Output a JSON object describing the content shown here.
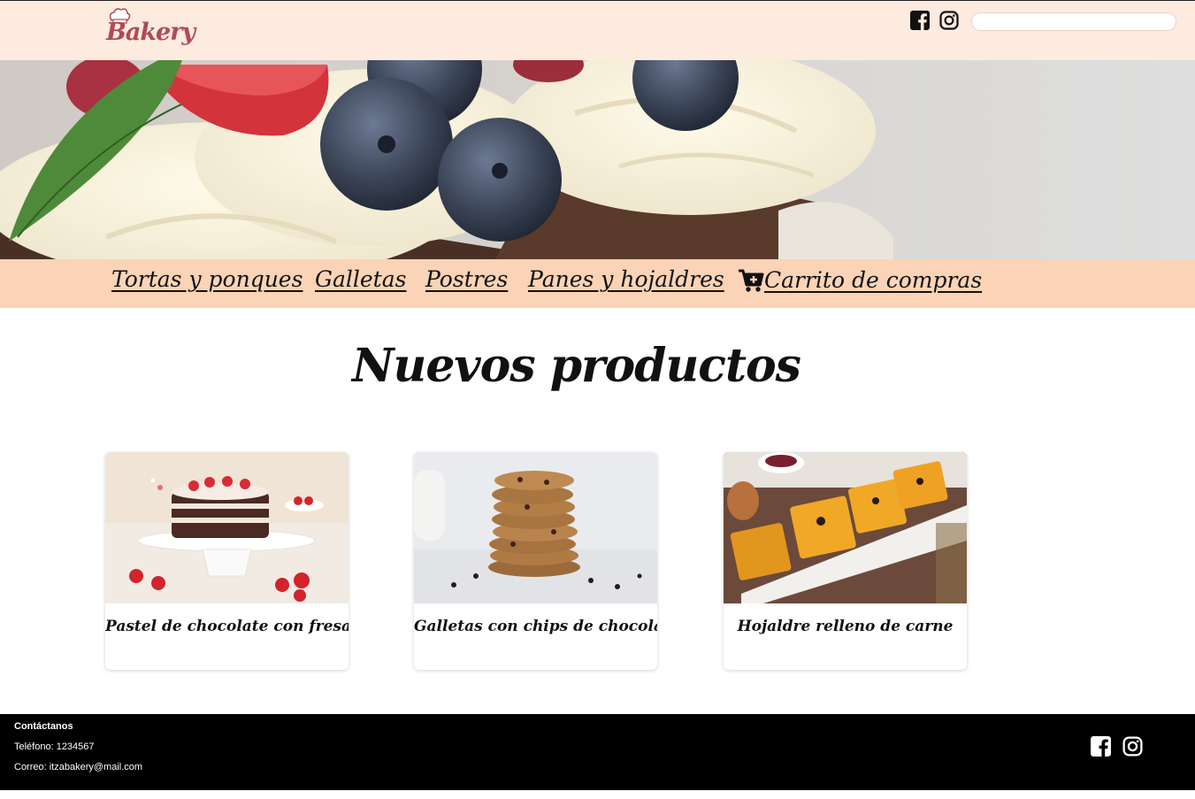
{
  "header": {
    "logo_text": "Bakery",
    "search": {
      "value": "",
      "placeholder": ""
    }
  },
  "nav": {
    "items": [
      {
        "label": "Tortas y ponques"
      },
      {
        "label": "Galletas"
      },
      {
        "label": "Postres"
      },
      {
        "label": "Panes y hojaldres"
      }
    ],
    "cart_label": "Carrito de compras"
  },
  "main": {
    "title": "Nuevos productos",
    "products": [
      {
        "name": "Pastel de chocolate con fresas"
      },
      {
        "name": "Galletas con chips de chocolate"
      },
      {
        "name": "Hojaldre relleno de carne"
      }
    ]
  },
  "footer": {
    "contact_heading": "Contáctanos",
    "phone": "Teléfono: 1234567",
    "email": "Correo: itzabakery@mail.com"
  },
  "icons": [
    "facebook-icon",
    "instagram-icon",
    "cart-icon",
    "chef-hat-icon"
  ],
  "colors": {
    "header_bg": "#fdebe0",
    "nav_bg": "#fbd3b6",
    "footer_bg": "#000000",
    "logo": "#b04a55"
  }
}
